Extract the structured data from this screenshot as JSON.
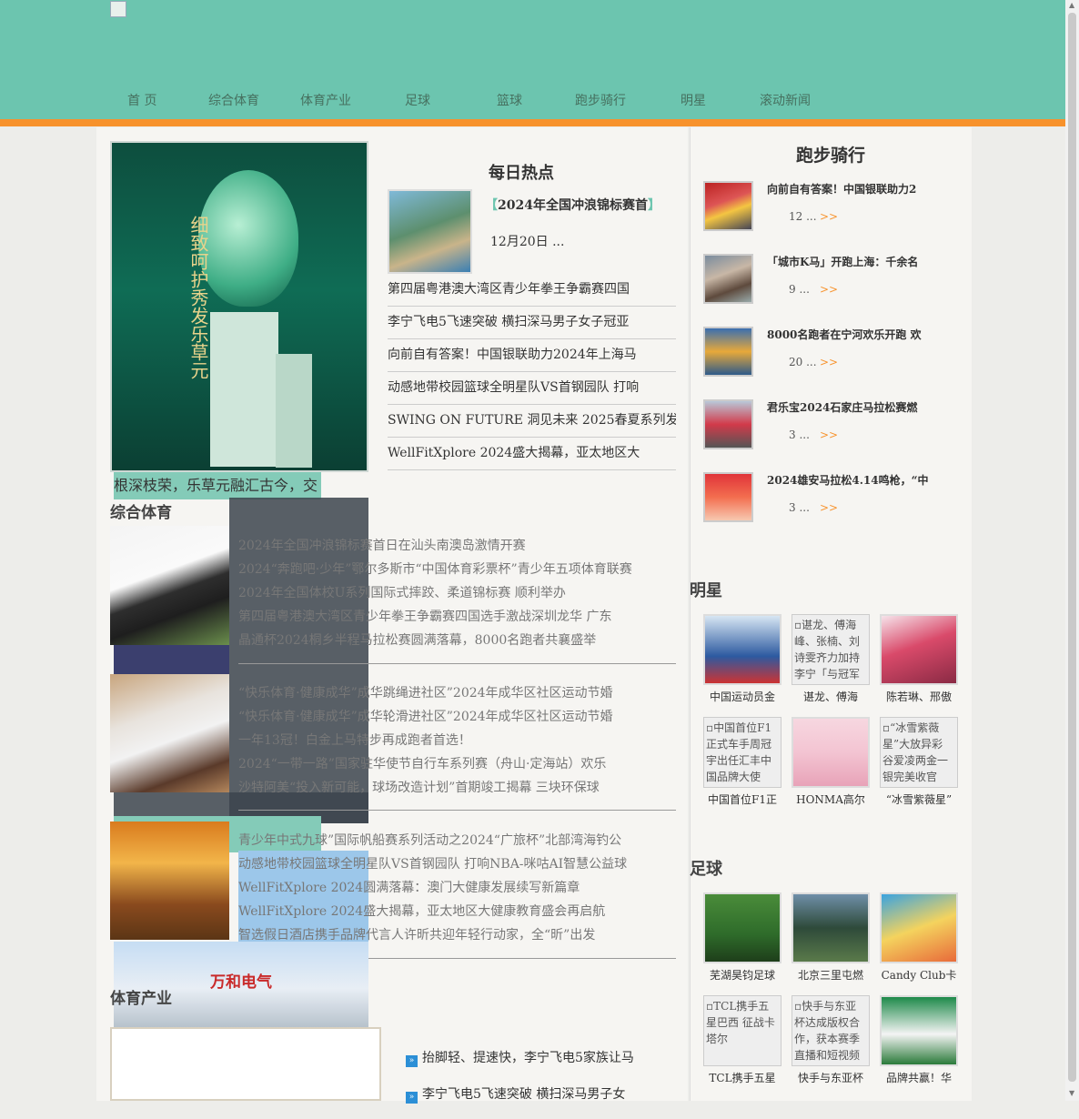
{
  "nav": {
    "items": [
      "首 页",
      "综合体育",
      "体育产业",
      "足球",
      "篮球",
      "跑步骑行",
      "明星",
      "滚动新闻"
    ]
  },
  "ad": {
    "caption": "根深枝荣，乐草元融汇古今，交",
    "vertical_text": "细致呵护秀发乐草元"
  },
  "hot": {
    "title": "每日热点",
    "headline": "2024年全国冲浪锦标赛首",
    "bracket_open": "【",
    "bracket_close": "】",
    "date": "12月20日 ...",
    "items": [
      "第四届粤港澳大湾区青少年拳王争霸赛四国",
      "李宁飞电5飞速突破 横扫深马男子女子冠亚",
      "向前自有答案！中国银联助力2024年上海马",
      "动感地带校园篮球全明星队VS首钢园队 打响",
      "SWING ON FUTURE 洞见未来 2025春夏系列发",
      "WellFitXplore 2024盛大揭幕，亚太地区大"
    ]
  },
  "sections": {
    "zonghe": "综合体育",
    "chanye": "体育产业"
  },
  "news_groups": [
    [
      "2024年全国冲浪锦标赛首日在汕头南澳岛激情开赛",
      "2024“奔跑吧·少年”鄂尔多斯市“中国体育彩票杯”青少年五项体育联赛",
      "2024年全国体校U系列国际式摔跤、柔道锦标赛 顺利举办",
      "第四届粤港澳大湾区青少年拳王争霸赛四国选手激战深圳龙华 广东",
      "晶通杯2024桐乡半程马拉松赛圆满落幕，8000名跑者共襄盛举"
    ],
    [
      "“快乐体育·健康成华”成华跳绳进社区”2024年成华区社区运动节婚",
      "“快乐体育·健康成华”成华轮滑进社区”2024年成华区社区运动节婚",
      "一年13冠！白金上马特步再成跑者首选！",
      "2024“一带一路”国家驻华使节自行车系列赛（舟山·定海站）欢乐",
      "沙特阿美“投入新可能，球场改造计划”首期竣工揭幕 三块环保球"
    ],
    [
      "青少年中式九球”国际帆船赛系列活动之2024“广旅杯”北部湾海钓公",
      "动感地带校园篮球全明星队VS首钢园队 打响NBA-咪咕AI智慧公益球",
      "WellFitXplore 2024圆满落幕：澳门大健康发展续写新篇章",
      "WellFitXplore 2024盛大揭幕，亚太地区大健康教育盛会再启航",
      "智选假日酒店携手品牌代言人许昕共迎年轻行动家，全“昕”出发"
    ]
  ],
  "industry": {
    "ad_text": "万和电气",
    "items": [
      "抬脚轻、提速快，李宁飞电5家族让马",
      "李宁飞电5飞速突破 横扫深马男子女"
    ]
  },
  "running": {
    "title": "跑步骑行",
    "more": ">>",
    "items": [
      {
        "title": "向前自有答案！中国银联助力2",
        "count": "12 ..."
      },
      {
        "title": "「城市K马」开跑上海：千余名",
        "count": "9 ..."
      },
      {
        "title": "8000名跑者在宁河欢乐开跑 欢",
        "count": "20 ..."
      },
      {
        "title": "君乐宝2024石家庄马拉松赛燃",
        "count": "3 ..."
      },
      {
        "title": "2024雄安马拉松4.14鸣枪，“中",
        "count": "3 ..."
      }
    ]
  },
  "stars": {
    "title": "明星",
    "cards": [
      {
        "caption": "中国运动员金",
        "alt": ""
      },
      {
        "caption": "谌龙、傅海",
        "alt": "谌龙、傅海峰、张楠、刘诗雯齐力加持李宁「与冠军"
      },
      {
        "caption": "陈若琳、邢傲",
        "alt": ""
      },
      {
        "caption": "中国首位F1正",
        "alt": "中国首位F1正式车手周冠宇出任汇丰中国品牌大使"
      },
      {
        "caption": "HONMA高尔",
        "alt": ""
      },
      {
        "caption": "“冰雪紫薇星”",
        "alt": "“冰雪紫薇星”大放异彩 谷爱凌两金一银完美收官"
      }
    ]
  },
  "football": {
    "title": "足球",
    "cards": [
      {
        "caption": "芜湖昊钧足球",
        "alt": ""
      },
      {
        "caption": "北京三里屯燃",
        "alt": ""
      },
      {
        "caption": "Candy Club卡",
        "alt": ""
      },
      {
        "caption": "TCL携手五星",
        "alt": "TCL携手五星巴西 征战卡塔尔"
      },
      {
        "caption": "快手与东亚杯",
        "alt": "快手与东亚杯达成版权合作，获本赛季直播和短视频"
      },
      {
        "caption": "品牌共赢！华",
        "alt": ""
      }
    ]
  }
}
